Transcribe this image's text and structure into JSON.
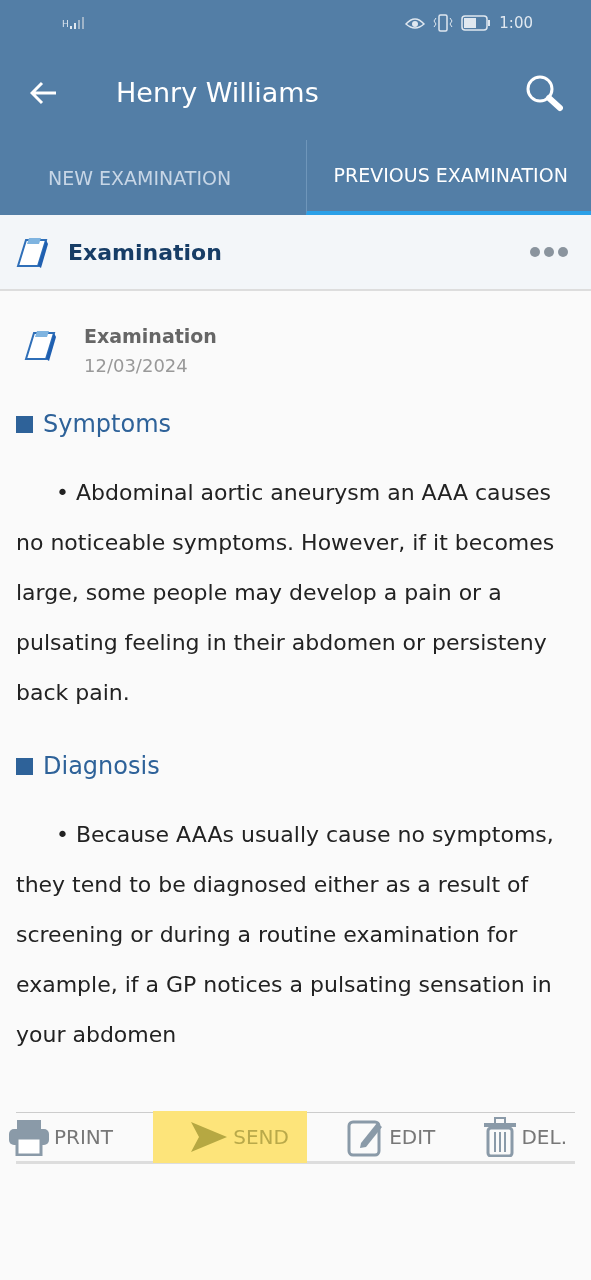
{
  "status_bar": {
    "network": "H",
    "time": "1:00"
  },
  "app_bar": {
    "title": "Henry Williams"
  },
  "tabs": [
    {
      "label": "NEW EXAMINATION",
      "selected": false
    },
    {
      "label": "PREVIOUS EXAMINATION",
      "selected": true
    }
  ],
  "section_header": {
    "title": "Examination"
  },
  "record": {
    "title": "Examination",
    "date": "12/03/2024"
  },
  "sections": [
    {
      "heading": "Symptoms",
      "text": "• Abdominal aortic aneurysm an AAA causes no noticeable symptoms. However, if it becomes large, some people may develop a pain or a pulsating feeling in their abdomen or persisteny back pain."
    },
    {
      "heading": "Diagnosis",
      "text": "• Because AAAs usually cause no symptoms, they tend to be diagnosed either as a result of screening or during a routine examination for example, if a GP notices a pulsating sensation in your abdomen"
    }
  ],
  "toolbar": [
    {
      "kind": "print",
      "label": "PRINT",
      "highlighted": false
    },
    {
      "kind": "send",
      "label": "SEND",
      "highlighted": true
    },
    {
      "kind": "edit",
      "label": "EDIT",
      "highlighted": false
    },
    {
      "kind": "delete",
      "label": "DEL.",
      "highlighted": false
    }
  ]
}
